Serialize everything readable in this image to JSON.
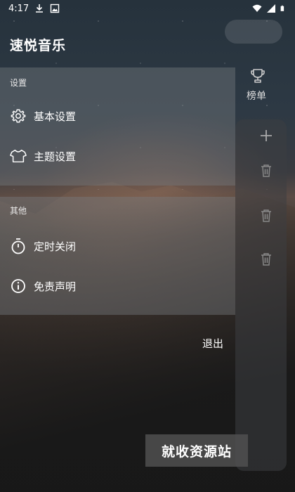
{
  "status_bar": {
    "time": "4:17",
    "icons": [
      "download-icon",
      "image-icon",
      "wifi-icon",
      "signal-icon",
      "battery-icon"
    ]
  },
  "app": {
    "title": "速悦音乐"
  },
  "drawer": {
    "settings_section": {
      "title": "设置",
      "items": [
        {
          "label": "基本设置",
          "icon": "gear-icon"
        },
        {
          "label": "主题设置",
          "icon": "shirt-icon"
        }
      ]
    },
    "others_section": {
      "title": "其他",
      "items": [
        {
          "label": "定时关闭",
          "icon": "timer-icon"
        },
        {
          "label": "免责声明",
          "icon": "info-icon"
        }
      ]
    },
    "logout_label": "退出"
  },
  "background_app": {
    "rank_label": "榜单",
    "icons": [
      "trophy-icon",
      "plus-icon",
      "trash-icon",
      "trash-icon",
      "trash-icon"
    ]
  },
  "watermark": {
    "text": "就收资源站"
  }
}
